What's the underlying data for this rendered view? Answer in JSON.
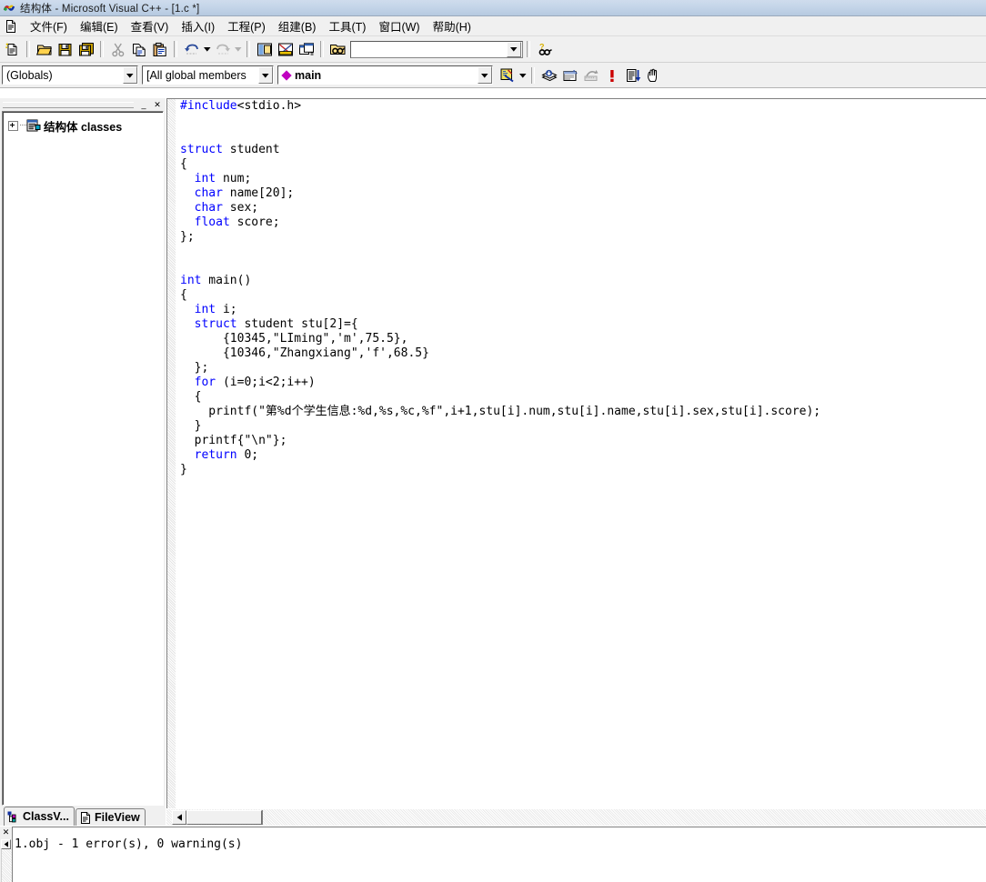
{
  "window": {
    "title": "结构体 - Microsoft Visual C++ - [1.c *]",
    "app_icon": "visual-cpp-icon"
  },
  "menubar": {
    "doc_icon": "document-icon",
    "items": [
      {
        "label": "文件(F)"
      },
      {
        "label": "编辑(E)"
      },
      {
        "label": "查看(V)"
      },
      {
        "label": "插入(I)"
      },
      {
        "label": "工程(P)"
      },
      {
        "label": "组建(B)"
      },
      {
        "label": "工具(T)"
      },
      {
        "label": "窗口(W)"
      },
      {
        "label": "帮助(H)"
      }
    ]
  },
  "standard_toolbar": {
    "buttons": [
      {
        "name": "new-text-file-icon"
      },
      {
        "name": "open-icon"
      },
      {
        "name": "save-icon"
      },
      {
        "name": "save-all-icon"
      },
      {
        "name": "cut-icon"
      },
      {
        "name": "copy-icon"
      },
      {
        "name": "paste-icon"
      },
      {
        "name": "undo-icon"
      },
      {
        "name": "redo-icon"
      },
      {
        "name": "workspace-toggle-icon"
      },
      {
        "name": "output-window-toggle-icon"
      },
      {
        "name": "window-list-icon"
      },
      {
        "name": "find-in-files-icon"
      },
      {
        "name": "search-help-icon"
      }
    ],
    "find_combo": {
      "value": "",
      "placeholder": ""
    }
  },
  "wizardbar": {
    "class_combo": {
      "value": "(Globals)"
    },
    "filter_combo": {
      "value": "[All global members"
    },
    "member_combo": {
      "value": "main",
      "icon": "member-diamond-icon"
    },
    "action_button": {
      "name": "wizardbar-actions-icon"
    }
  },
  "build_toolbar": {
    "buttons": [
      {
        "name": "compile-icon"
      },
      {
        "name": "build-icon"
      },
      {
        "name": "stop-build-icon",
        "disabled": true
      },
      {
        "name": "go-execute-icon"
      },
      {
        "name": "insert-remove-breakpoint-icon"
      },
      {
        "name": "hand-icon"
      }
    ]
  },
  "workspace": {
    "minimize_label": "_",
    "close_label": "✕",
    "tree": {
      "expander": "+",
      "icon": "class-folder-icon",
      "label": "结构体 classes"
    },
    "tabs": [
      {
        "label": "ClassV...",
        "icon": "classview-icon",
        "active": true
      },
      {
        "label": "FileView",
        "icon": "fileview-icon",
        "active": false
      }
    ]
  },
  "editor": {
    "filename": "1.c *",
    "code_lines": [
      [
        {
          "t": "#include",
          "k": true
        },
        {
          "t": "<stdio.h>",
          "k": false
        }
      ],
      [],
      [],
      [
        {
          "t": "struct",
          "k": true
        },
        {
          "t": " student",
          "k": false
        }
      ],
      [
        {
          "t": "{",
          "k": false
        }
      ],
      [
        {
          "t": "  ",
          "k": false
        },
        {
          "t": "int",
          "k": true
        },
        {
          "t": " num;",
          "k": false
        }
      ],
      [
        {
          "t": "  ",
          "k": false
        },
        {
          "t": "char",
          "k": true
        },
        {
          "t": " name[20];",
          "k": false
        }
      ],
      [
        {
          "t": "  ",
          "k": false
        },
        {
          "t": "char",
          "k": true
        },
        {
          "t": " sex;",
          "k": false
        }
      ],
      [
        {
          "t": "  ",
          "k": false
        },
        {
          "t": "float",
          "k": true
        },
        {
          "t": " score;",
          "k": false
        }
      ],
      [
        {
          "t": "};",
          "k": false
        }
      ],
      [],
      [],
      [
        {
          "t": "int",
          "k": true
        },
        {
          "t": " main()",
          "k": false
        }
      ],
      [
        {
          "t": "{",
          "k": false
        }
      ],
      [
        {
          "t": "  ",
          "k": false
        },
        {
          "t": "int",
          "k": true
        },
        {
          "t": " i;",
          "k": false
        }
      ],
      [
        {
          "t": "  ",
          "k": false
        },
        {
          "t": "struct",
          "k": true
        },
        {
          "t": " student stu[2]={",
          "k": false
        }
      ],
      [
        {
          "t": "      {10345,\"LIming\",'m',75.5},",
          "k": false
        }
      ],
      [
        {
          "t": "      {10346,\"Zhangxiang\",'f',68.5}",
          "k": false
        }
      ],
      [
        {
          "t": "  };",
          "k": false
        }
      ],
      [
        {
          "t": "  ",
          "k": false
        },
        {
          "t": "for",
          "k": true
        },
        {
          "t": " (i=0;i<2;i++)",
          "k": false
        }
      ],
      [
        {
          "t": "  {",
          "k": false
        }
      ],
      [
        {
          "t": "    printf(\"第%d个学生信息:%d,%s,%c,%f\",i+1,stu[i].num,stu[i].name,stu[i].sex,stu[i].score);",
          "k": false
        }
      ],
      [
        {
          "t": "  }",
          "k": false
        }
      ],
      [
        {
          "t": "  printf{\"\\n\"};",
          "k": false
        }
      ],
      [
        {
          "t": "  ",
          "k": false
        },
        {
          "t": "return",
          "k": true
        },
        {
          "t": " 0;",
          "k": false
        }
      ],
      [
        {
          "t": "}",
          "k": false
        }
      ]
    ],
    "hscroll": {
      "left_arrow": "◄"
    }
  },
  "output_pane": {
    "close_label": "✕",
    "scroll_up_label": "◄",
    "lines": [
      "1.obj - 1 error(s), 0 warning(s)"
    ]
  },
  "colors": {
    "keyword": "#0000ff",
    "text": "#000000",
    "editor_bg": "#ffffff",
    "chrome_bg": "#f0f0f0",
    "titlebar_from": "#cfdced",
    "titlebar_to": "#b6c9e0",
    "member_icon": "#c000c0",
    "error_icon": "#cc0000"
  }
}
